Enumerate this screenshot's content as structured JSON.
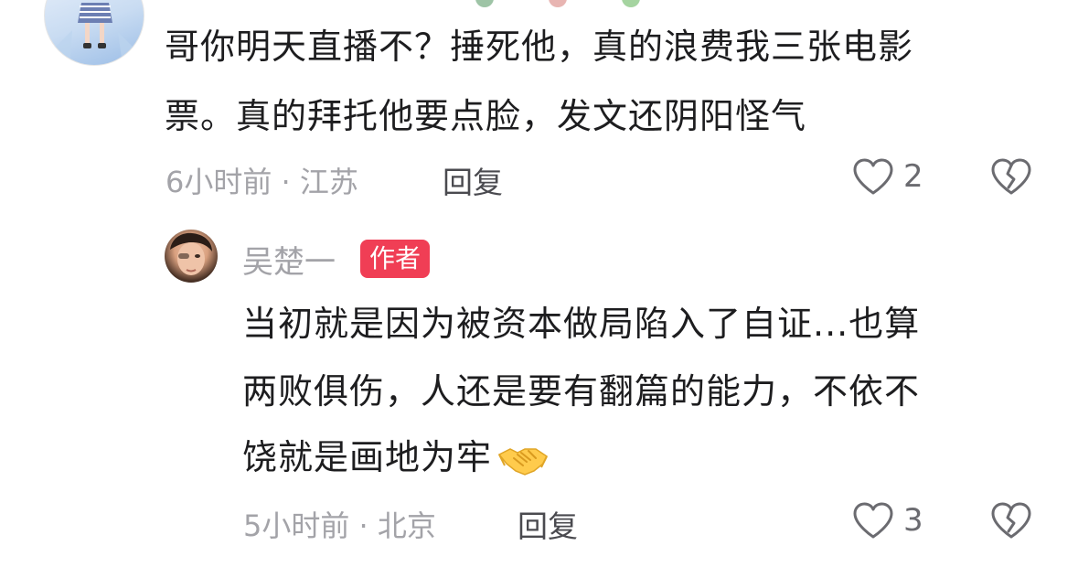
{
  "comment1": {
    "text_line1": "哥你明天直播不？捶死他，真的浪费我三张电影",
    "text_line2": "票。真的拜托他要点脸，发文还阴阳怪气",
    "meta": "6小时前 · 江苏",
    "reply_label": "回复",
    "like_count": "2",
    "avatar_icon": "anime-girl-avatar"
  },
  "reply1": {
    "author": "吴楚一",
    "badge": "作者",
    "text_line1": "当初就是因为被资本做局陷入了自证...也算",
    "text_line2": "两败俱伤，人还是要有翻篇的能力，不依不",
    "text_line3": "饶就是画地为牢",
    "emoji": "handshake-emoji",
    "meta": "5小时前 · 北京",
    "reply_label": "回复",
    "like_count": "3",
    "avatar_icon": "author-portrait-avatar"
  },
  "colors": {
    "badge_bg": "#f03e55",
    "meta_text": "#a3a3a8",
    "body_text": "#1d1d1f"
  }
}
